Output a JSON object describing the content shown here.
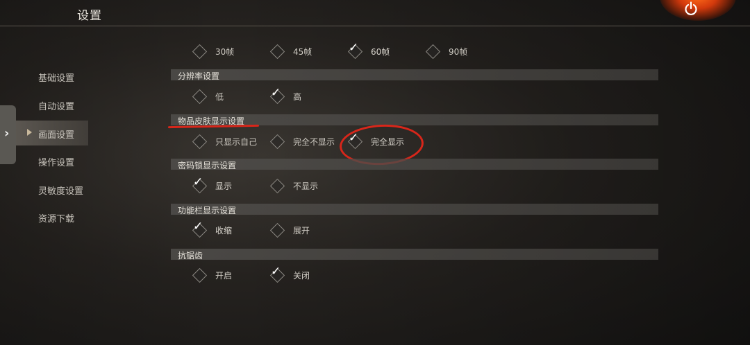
{
  "header": {
    "title": "设置"
  },
  "sidebar": {
    "items": [
      {
        "label": "基础设置"
      },
      {
        "label": "自动设置"
      },
      {
        "label": "画面设置",
        "active": true
      },
      {
        "label": "操作设置"
      },
      {
        "label": "灵敏度设置"
      },
      {
        "label": "资源下载"
      }
    ]
  },
  "frame_rate": {
    "options": [
      {
        "label": "30帧",
        "selected": false
      },
      {
        "label": "45帧",
        "selected": false
      },
      {
        "label": "60帧",
        "selected": true
      },
      {
        "label": "90帧",
        "selected": false
      }
    ]
  },
  "resolution": {
    "title": "分辨率设置",
    "options": [
      {
        "label": "低",
        "selected": false
      },
      {
        "label": "高",
        "selected": true
      }
    ]
  },
  "item_skin": {
    "title": "物品皮肤显示设置",
    "options": [
      {
        "label": "只显示自己",
        "selected": false
      },
      {
        "label": "完全不显示",
        "selected": false
      },
      {
        "label": "完全显示",
        "selected": true
      }
    ]
  },
  "code_lock": {
    "title": "密码锁显示设置",
    "options": [
      {
        "label": "显示",
        "selected": true
      },
      {
        "label": "不显示",
        "selected": false
      }
    ]
  },
  "function_bar": {
    "title": "功能栏显示设置",
    "options": [
      {
        "label": "收缩",
        "selected": true
      },
      {
        "label": "展开",
        "selected": false
      }
    ]
  },
  "antialias": {
    "title": "抗锯齿",
    "options": [
      {
        "label": "开启",
        "selected": false
      },
      {
        "label": "关闭",
        "selected": true
      }
    ]
  },
  "icons": {
    "power": "power-icon",
    "side_tab": "chevron-right-icon",
    "check": "checkmark-icon"
  },
  "colors": {
    "annotation": "#d8261a",
    "power_glow": "#ff6a1a"
  }
}
